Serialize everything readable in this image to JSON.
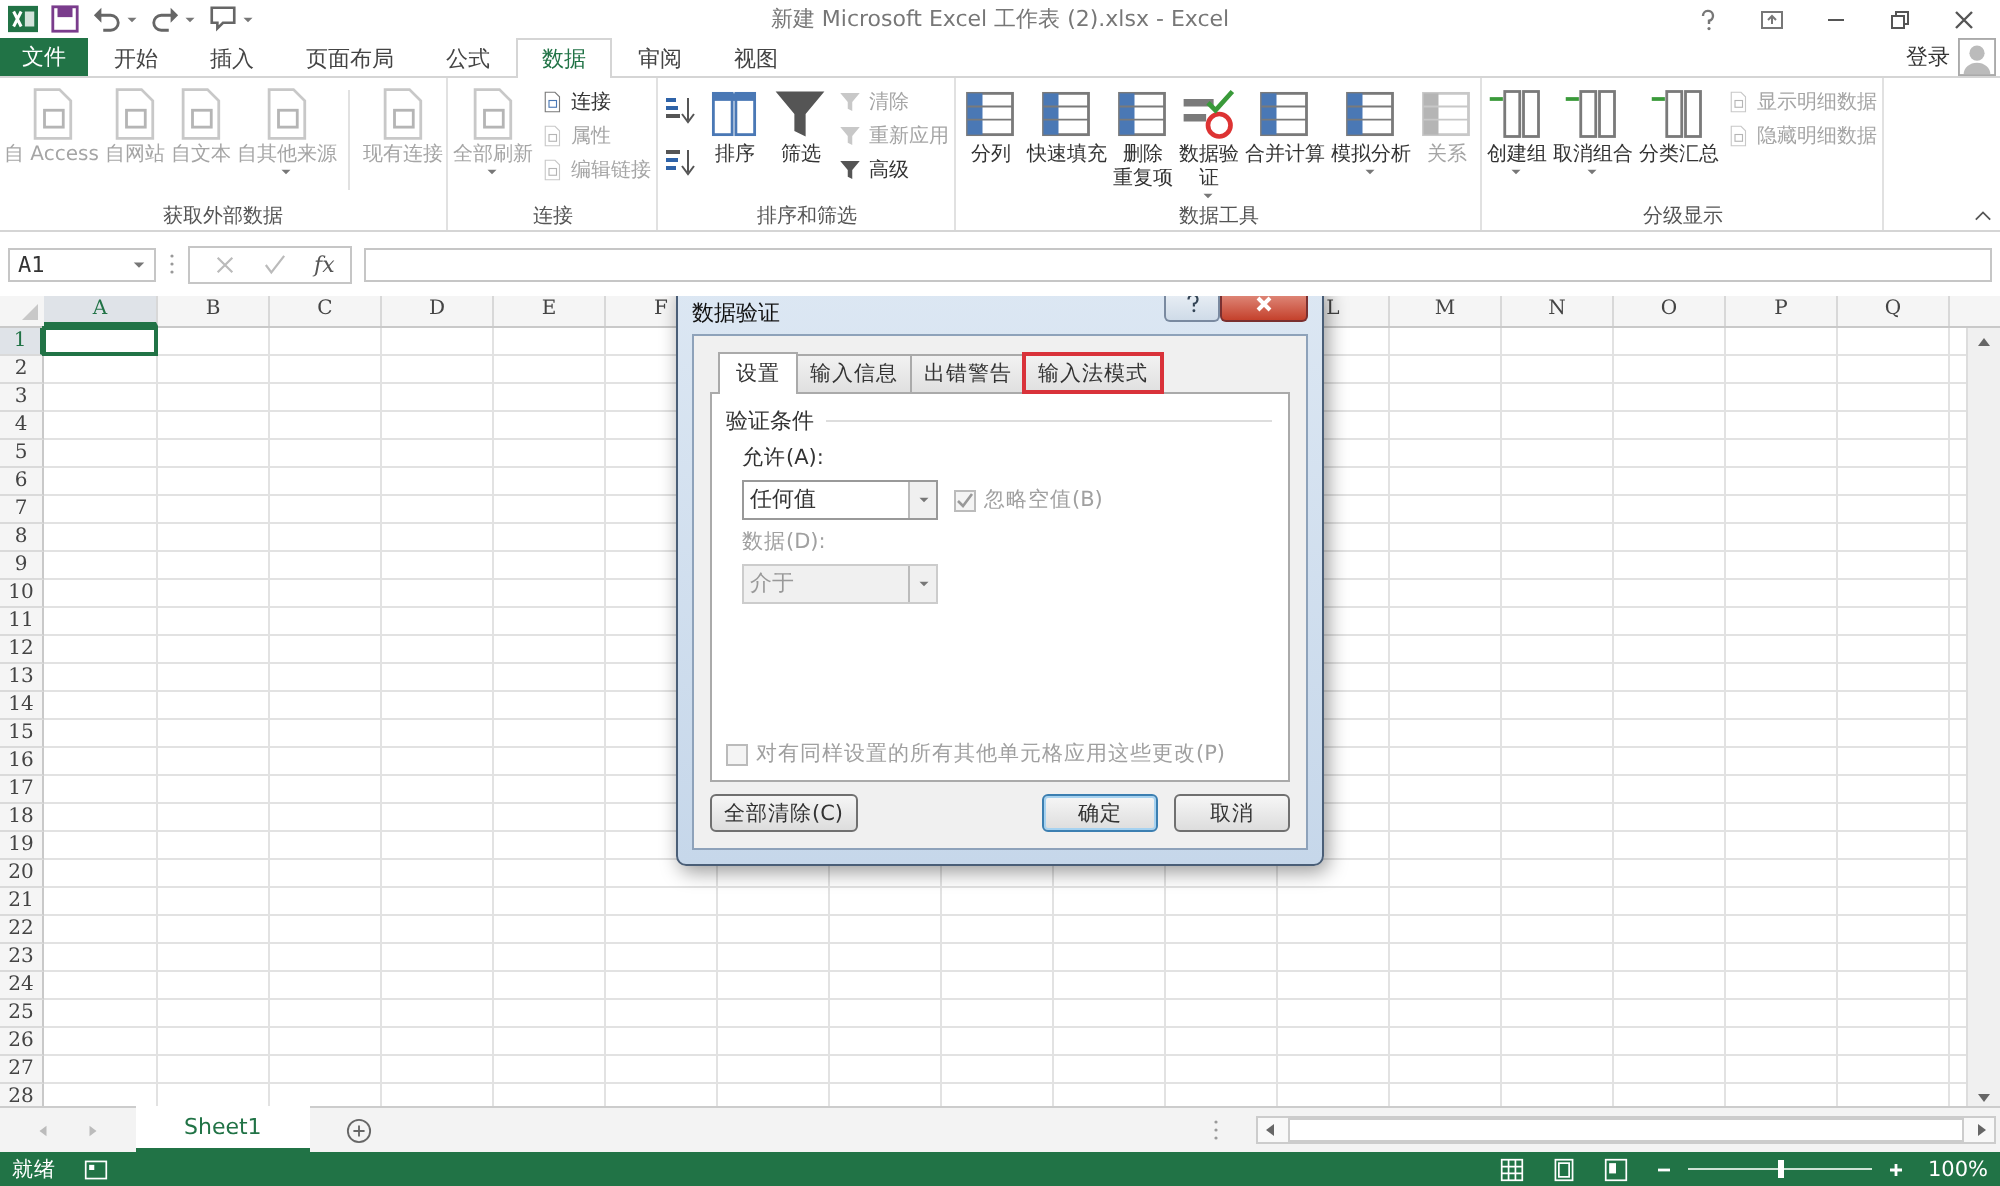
{
  "title_bar": {
    "title": "新建 Microsoft Excel 工作表 (2).xlsx - Excel"
  },
  "ribbon_tabs": [
    {
      "label": "文件",
      "kind": "file",
      "selected": false
    },
    {
      "label": "开始",
      "kind": "tab",
      "selected": false
    },
    {
      "label": "插入",
      "kind": "tab",
      "selected": false
    },
    {
      "label": "页面布局",
      "kind": "tab",
      "selected": false
    },
    {
      "label": "公式",
      "kind": "tab",
      "selected": false
    },
    {
      "label": "数据",
      "kind": "tab",
      "selected": true
    },
    {
      "label": "审阅",
      "kind": "tab",
      "selected": false
    },
    {
      "label": "视图",
      "kind": "tab",
      "selected": false
    }
  ],
  "account": {
    "label": "登录"
  },
  "ribbon_groups": [
    {
      "label": "获取外部数据",
      "items": [
        {
          "kind": "large",
          "label": "自 Access",
          "disabled": true,
          "dropdown": false
        },
        {
          "kind": "large",
          "label": "自网站",
          "disabled": true,
          "dropdown": false
        },
        {
          "kind": "large",
          "label": "自文本",
          "disabled": true,
          "dropdown": false
        },
        {
          "kind": "large",
          "label": "自其他来源",
          "disabled": true,
          "dropdown": true
        },
        {
          "kind": "separator"
        },
        {
          "kind": "large",
          "label": "现有连接",
          "disabled": true,
          "dropdown": false
        }
      ]
    },
    {
      "label": "连接",
      "items": [
        {
          "kind": "large",
          "label": "全部刷新",
          "disabled": true,
          "dropdown": true
        },
        {
          "kind": "stack",
          "items": [
            {
              "label": "连接",
              "disabled": false
            },
            {
              "label": "属性",
              "disabled": true
            },
            {
              "label": "编辑链接",
              "disabled": true
            }
          ]
        }
      ]
    },
    {
      "label": "排序和筛选",
      "items": [
        {
          "kind": "sort_buttons"
        },
        {
          "kind": "large",
          "label": "排序",
          "disabled": false,
          "dropdown": false
        },
        {
          "kind": "large",
          "label": "筛选",
          "disabled": false,
          "dropdown": false
        },
        {
          "kind": "stack",
          "items": [
            {
              "label": "清除",
              "disabled": true
            },
            {
              "label": "重新应用",
              "disabled": true
            },
            {
              "label": "高级",
              "disabled": false
            }
          ]
        }
      ]
    },
    {
      "label": "数据工具",
      "items": [
        {
          "kind": "large",
          "label": "分列",
          "disabled": false,
          "dropdown": false
        },
        {
          "kind": "large",
          "label": "快速填充",
          "disabled": false,
          "dropdown": false
        },
        {
          "kind": "large",
          "lines": [
            "删除",
            "重复项"
          ],
          "disabled": false,
          "dropdown": false
        },
        {
          "kind": "large",
          "lines": [
            "数据验",
            "证"
          ],
          "disabled": false,
          "dropdown": true
        },
        {
          "kind": "large",
          "label": "合并计算",
          "disabled": false,
          "dropdown": false
        },
        {
          "kind": "large",
          "label": "模拟分析",
          "disabled": false,
          "dropdown": true
        },
        {
          "kind": "large",
          "label": "关系",
          "disabled": true,
          "dropdown": false
        }
      ]
    },
    {
      "label": "分级显示",
      "items": [
        {
          "kind": "large",
          "label": "创建组",
          "disabled": false,
          "dropdown": true
        },
        {
          "kind": "large",
          "label": "取消组合",
          "disabled": false,
          "dropdown": true
        },
        {
          "kind": "large",
          "label": "分类汇总",
          "disabled": false,
          "dropdown": false
        },
        {
          "kind": "stack",
          "items": [
            {
              "label": "显示明细数据",
              "disabled": true
            },
            {
              "label": "隐藏明细数据",
              "disabled": true
            }
          ]
        }
      ]
    }
  ],
  "formula_bar": {
    "name_box": "A1",
    "fx": "fx"
  },
  "sheet": {
    "columns": [
      {
        "label": "A",
        "selected": true
      },
      {
        "label": "B",
        "selected": false
      },
      {
        "label": "C",
        "selected": false
      },
      {
        "label": "D",
        "selected": false
      },
      {
        "label": "E",
        "selected": false
      },
      {
        "label": "F",
        "selected": false
      }
    ],
    "columns_right": [
      {
        "label": "L",
        "selected": false
      },
      {
        "label": "M",
        "selected": false
      },
      {
        "label": "N",
        "selected": false
      },
      {
        "label": "O",
        "selected": false
      },
      {
        "label": "P",
        "selected": false
      },
      {
        "label": "Q",
        "selected": false
      }
    ],
    "rows": [
      {
        "label": "1",
        "selected": true
      },
      {
        "label": "2",
        "selected": false
      },
      {
        "label": "3",
        "selected": false
      },
      {
        "label": "4",
        "selected": false
      },
      {
        "label": "5",
        "selected": false
      },
      {
        "label": "6",
        "selected": false
      },
      {
        "label": "7",
        "selected": false
      },
      {
        "label": "8",
        "selected": false
      },
      {
        "label": "9",
        "selected": false
      },
      {
        "label": "10",
        "selected": false
      },
      {
        "label": "11",
        "selected": false
      },
      {
        "label": "12",
        "selected": false
      },
      {
        "label": "13",
        "selected": false
      },
      {
        "label": "14",
        "selected": false
      },
      {
        "label": "15",
        "selected": false
      },
      {
        "label": "16",
        "selected": false
      },
      {
        "label": "17",
        "selected": false
      },
      {
        "label": "18",
        "selected": false
      },
      {
        "label": "19",
        "selected": false
      },
      {
        "label": "20",
        "selected": false
      },
      {
        "label": "21",
        "selected": false
      },
      {
        "label": "22",
        "selected": false
      },
      {
        "label": "23",
        "selected": false
      },
      {
        "label": "24",
        "selected": false
      },
      {
        "label": "25",
        "selected": false
      },
      {
        "label": "26",
        "selected": false
      },
      {
        "label": "27",
        "selected": false
      },
      {
        "label": "28",
        "selected": false
      }
    ]
  },
  "sheet_tabs": [
    {
      "label": "Sheet1",
      "selected": true
    }
  ],
  "status_bar": {
    "status": "就绪",
    "zoom": "100%",
    "zoom_slider": {
      "level": 0.5
    }
  },
  "dialog": {
    "title": "数据验证",
    "tabs": [
      {
        "label": "设置",
        "selected": true,
        "highlighted": false
      },
      {
        "label": "输入信息",
        "selected": false,
        "highlighted": false
      },
      {
        "label": "出错警告",
        "selected": false,
        "highlighted": false
      },
      {
        "label": "输入法模式",
        "selected": false,
        "highlighted": true
      }
    ],
    "section": "验证条件",
    "allow": {
      "label": "允许(A):",
      "value": "任何值",
      "disabled": false
    },
    "ignore_blank": {
      "label": "忽略空值(B)",
      "checked": true,
      "disabled": true
    },
    "data": {
      "label": "数据(D):",
      "value": "介于",
      "disabled": true
    },
    "apply_all": {
      "label": "对有同样设置的所有其他单元格应用这些更改(P)",
      "checked": false,
      "disabled": true
    },
    "buttons": [
      {
        "label": "全部清除(C)",
        "kind": "secondary"
      },
      {
        "label": "确定",
        "kind": "default"
      },
      {
        "label": "取消",
        "kind": "secondary"
      }
    ]
  }
}
